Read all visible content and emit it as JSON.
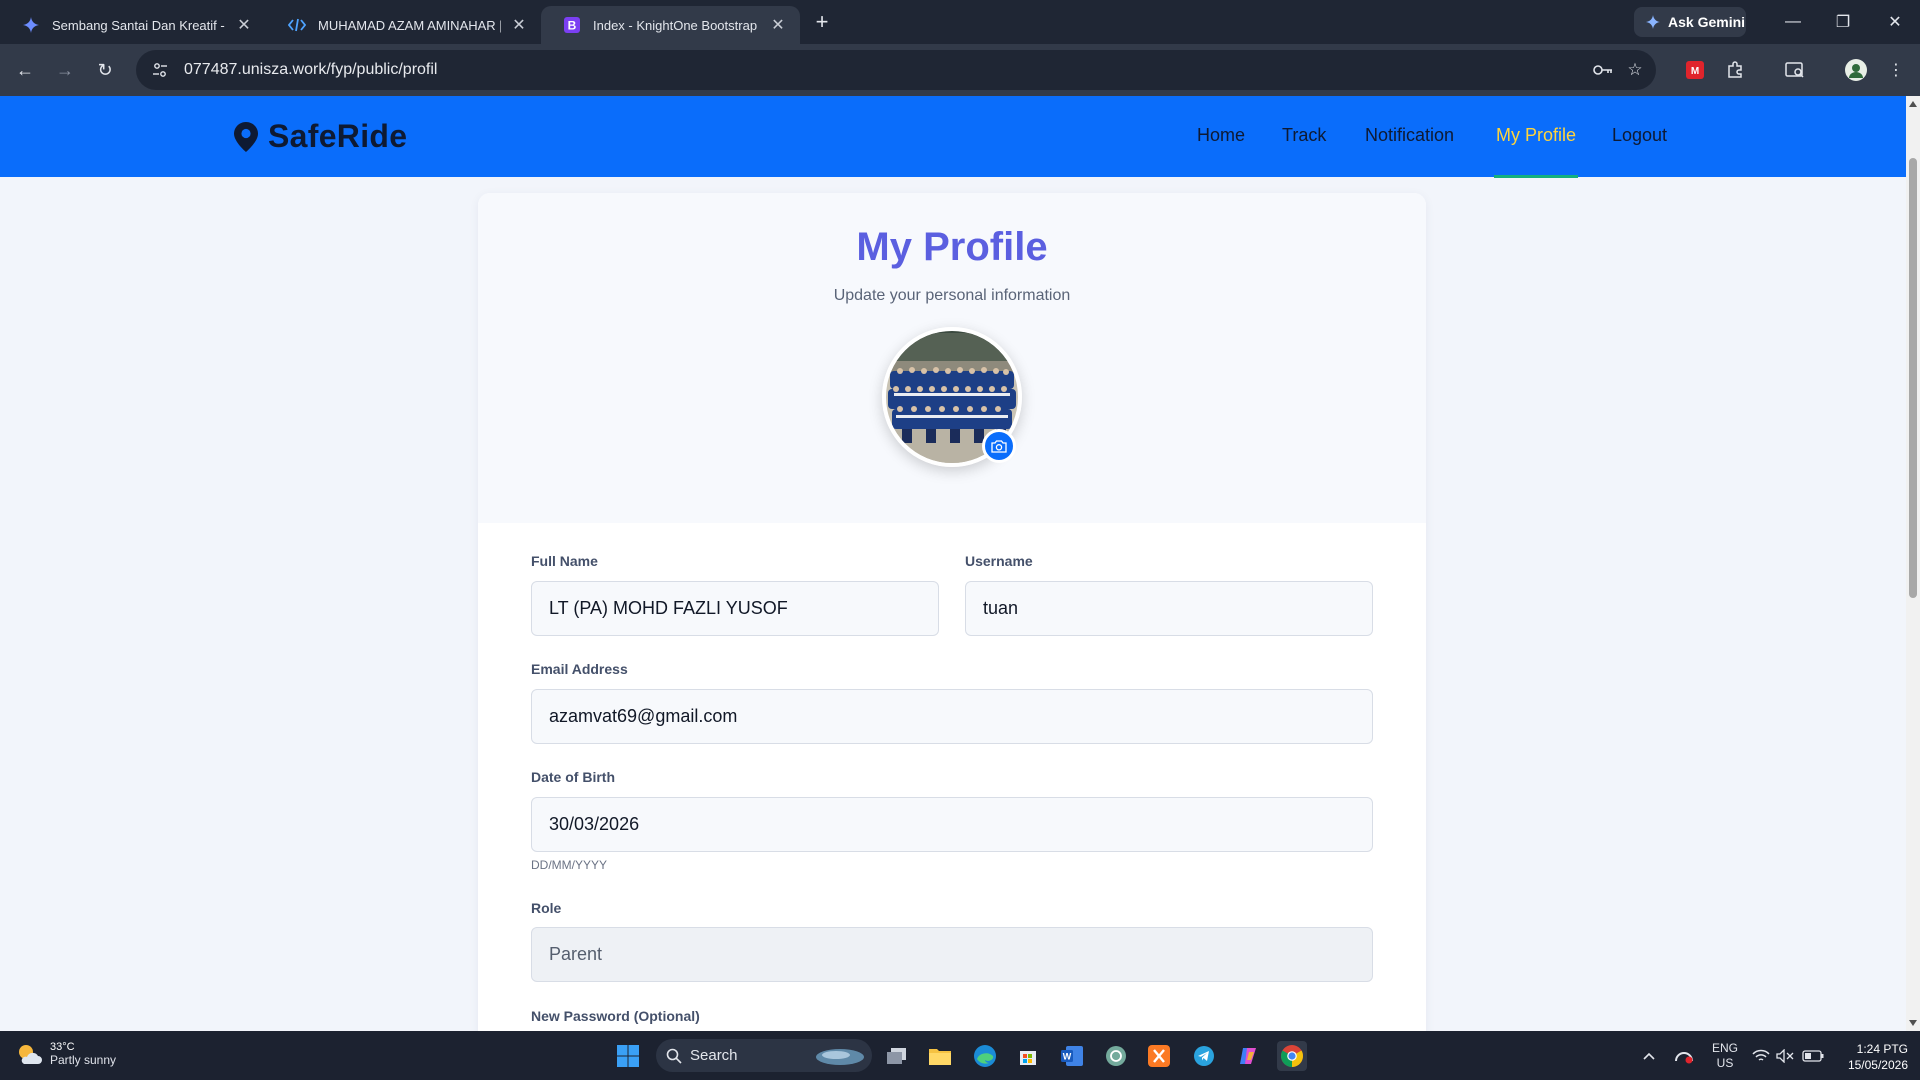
{
  "browser": {
    "tabs": [
      {
        "title": "Sembang Santai Dan Kreatif - Google Gemini",
        "active": false
      },
      {
        "title": "MUHAMAD AZAM AMINAHAR | e",
        "active": false
      },
      {
        "title": "Index - KnightOne Bootstrap Template",
        "active": true
      }
    ],
    "gemini_label": "Ask Gemini",
    "url": "077487.unisza.work/fyp/public/profil"
  },
  "site": {
    "logo": "SafeRide",
    "nav": [
      "Home",
      "Track",
      "Notification",
      "My Profile",
      "Logout"
    ],
    "active_nav": "My Profile"
  },
  "profile": {
    "title": "My Profile",
    "subtitle": "Update your personal information",
    "fields": {
      "full_name": {
        "label": "Full Name",
        "value": "LT (PA) MOHD FAZLI YUSOF"
      },
      "username": {
        "label": "Username",
        "value": "tuan"
      },
      "email": {
        "label": "Email Address",
        "value": "azamvat69@gmail.com"
      },
      "dob": {
        "label": "Date of Birth",
        "value": "30/03/2026",
        "hint": "DD/MM/YYYY"
      },
      "role": {
        "label": "Role",
        "value": "Parent"
      },
      "new_password": {
        "label": "New Password (Optional)"
      }
    }
  },
  "taskbar": {
    "weather_temp": "33°C",
    "weather_desc": "Partly sunny",
    "search_label": "Search",
    "lang_top": "ENG",
    "lang_bottom": "US",
    "time": "1:24 PTG",
    "date": "15/05/2026"
  },
  "colors": {
    "header_blue": "#0a6dfb",
    "title_purple": "#5b5fe0",
    "active_nav": "#ffd43b",
    "nav_underline": "#15b07e"
  }
}
